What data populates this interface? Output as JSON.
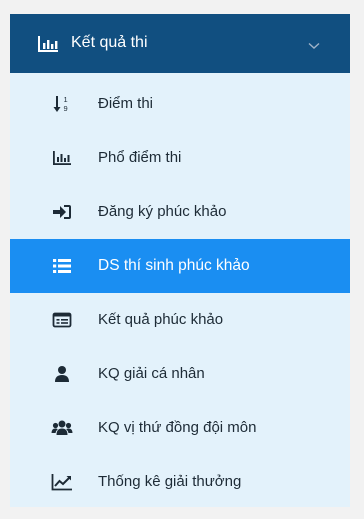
{
  "colors": {
    "header_bg": "#114f80",
    "menu_bg": "#e3f2fb",
    "active_bg": "#1a8ef2",
    "text": "#1d2b36",
    "active_text": "#ffffff"
  },
  "header": {
    "title": "Kết quả thi",
    "icon": "bar-chart-icon",
    "chevron": "chevron-down-icon"
  },
  "menu": {
    "items": [
      {
        "label": "Điểm thi",
        "icon": "sort-numeric-icon",
        "active": false
      },
      {
        "label": "Phổ điểm thi",
        "icon": "bar-chart-icon",
        "active": false
      },
      {
        "label": "Đăng ký phúc khảo",
        "icon": "sign-in-icon",
        "active": false
      },
      {
        "label": "DS thí sinh phúc khảo",
        "icon": "list-icon",
        "active": true
      },
      {
        "label": "Kết quả phúc khảo",
        "icon": "id-card-icon",
        "active": false
      },
      {
        "label": "KQ giải cá nhân",
        "icon": "user-icon",
        "active": false
      },
      {
        "label": "KQ vị thứ đồng đội môn",
        "icon": "users-icon",
        "active": false
      },
      {
        "label": "Thống kê giải thưởng",
        "icon": "line-chart-icon",
        "active": false
      }
    ]
  }
}
